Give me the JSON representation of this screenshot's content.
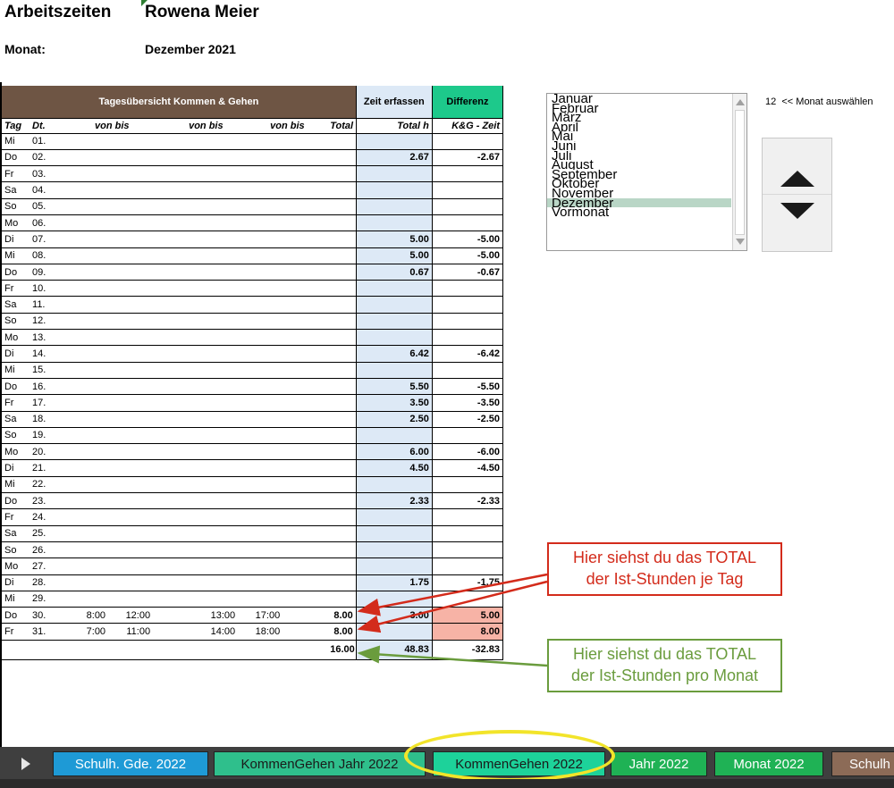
{
  "header": {
    "title": "Arbeitszeiten",
    "name": "Rowena Meier",
    "month_label": "Monat:",
    "month_value": "Dezember 2021"
  },
  "table": {
    "group_header": "Tagesübersicht Kommen & Gehen",
    "col_zeit": "Zeit erfassen",
    "col_diff": "Differenz",
    "sub": {
      "tag": "Tag",
      "dt": "Dt.",
      "vonbis1": "von  bis",
      "vonbis2": "von  bis",
      "vonbis3": "von  bis",
      "total": "Total h",
      "total2": "Total h",
      "kg": "K&G - Zeit"
    },
    "rows": [
      {
        "tag": "Mi",
        "dt": "01.",
        "v1": "",
        "b1": "",
        "v2": "",
        "b2": "",
        "total": "",
        "ze": "",
        "diff": ""
      },
      {
        "tag": "Do",
        "dt": "02.",
        "v1": "",
        "b1": "",
        "v2": "",
        "b2": "",
        "total": "",
        "ze": "2.67",
        "diff": "-2.67"
      },
      {
        "tag": "Fr",
        "dt": "03.",
        "v1": "",
        "b1": "",
        "v2": "",
        "b2": "",
        "total": "",
        "ze": "",
        "diff": ""
      },
      {
        "tag": "Sa",
        "dt": "04.",
        "v1": "",
        "b1": "",
        "v2": "",
        "b2": "",
        "total": "",
        "ze": "",
        "diff": ""
      },
      {
        "tag": "So",
        "dt": "05.",
        "v1": "",
        "b1": "",
        "v2": "",
        "b2": "",
        "total": "",
        "ze": "",
        "diff": ""
      },
      {
        "tag": "Mo",
        "dt": "06.",
        "v1": "",
        "b1": "",
        "v2": "",
        "b2": "",
        "total": "",
        "ze": "",
        "diff": ""
      },
      {
        "tag": "Di",
        "dt": "07.",
        "v1": "",
        "b1": "",
        "v2": "",
        "b2": "",
        "total": "",
        "ze": "5.00",
        "diff": "-5.00"
      },
      {
        "tag": "Mi",
        "dt": "08.",
        "v1": "",
        "b1": "",
        "v2": "",
        "b2": "",
        "total": "",
        "ze": "5.00",
        "diff": "-5.00"
      },
      {
        "tag": "Do",
        "dt": "09.",
        "v1": "",
        "b1": "",
        "v2": "",
        "b2": "",
        "total": "",
        "ze": "0.67",
        "diff": "-0.67"
      },
      {
        "tag": "Fr",
        "dt": "10.",
        "v1": "",
        "b1": "",
        "v2": "",
        "b2": "",
        "total": "",
        "ze": "",
        "diff": ""
      },
      {
        "tag": "Sa",
        "dt": "11.",
        "v1": "",
        "b1": "",
        "v2": "",
        "b2": "",
        "total": "",
        "ze": "",
        "diff": ""
      },
      {
        "tag": "So",
        "dt": "12.",
        "v1": "",
        "b1": "",
        "v2": "",
        "b2": "",
        "total": "",
        "ze": "",
        "diff": ""
      },
      {
        "tag": "Mo",
        "dt": "13.",
        "v1": "",
        "b1": "",
        "v2": "",
        "b2": "",
        "total": "",
        "ze": "",
        "diff": ""
      },
      {
        "tag": "Di",
        "dt": "14.",
        "v1": "",
        "b1": "",
        "v2": "",
        "b2": "",
        "total": "",
        "ze": "6.42",
        "diff": "-6.42"
      },
      {
        "tag": "Mi",
        "dt": "15.",
        "v1": "",
        "b1": "",
        "v2": "",
        "b2": "",
        "total": "",
        "ze": "",
        "diff": ""
      },
      {
        "tag": "Do",
        "dt": "16.",
        "v1": "",
        "b1": "",
        "v2": "",
        "b2": "",
        "total": "",
        "ze": "5.50",
        "diff": "-5.50"
      },
      {
        "tag": "Fr",
        "dt": "17.",
        "v1": "",
        "b1": "",
        "v2": "",
        "b2": "",
        "total": "",
        "ze": "3.50",
        "diff": "-3.50"
      },
      {
        "tag": "Sa",
        "dt": "18.",
        "v1": "",
        "b1": "",
        "v2": "",
        "b2": "",
        "total": "",
        "ze": "2.50",
        "diff": "-2.50"
      },
      {
        "tag": "So",
        "dt": "19.",
        "v1": "",
        "b1": "",
        "v2": "",
        "b2": "",
        "total": "",
        "ze": "",
        "diff": ""
      },
      {
        "tag": "Mo",
        "dt": "20.",
        "v1": "",
        "b1": "",
        "v2": "",
        "b2": "",
        "total": "",
        "ze": "6.00",
        "diff": "-6.00"
      },
      {
        "tag": "Di",
        "dt": "21.",
        "v1": "",
        "b1": "",
        "v2": "",
        "b2": "",
        "total": "",
        "ze": "4.50",
        "diff": "-4.50"
      },
      {
        "tag": "Mi",
        "dt": "22.",
        "v1": "",
        "b1": "",
        "v2": "",
        "b2": "",
        "total": "",
        "ze": "",
        "diff": ""
      },
      {
        "tag": "Do",
        "dt": "23.",
        "v1": "",
        "b1": "",
        "v2": "",
        "b2": "",
        "total": "",
        "ze": "2.33",
        "diff": "-2.33"
      },
      {
        "tag": "Fr",
        "dt": "24.",
        "v1": "",
        "b1": "",
        "v2": "",
        "b2": "",
        "total": "",
        "ze": "",
        "diff": ""
      },
      {
        "tag": "Sa",
        "dt": "25.",
        "v1": "",
        "b1": "",
        "v2": "",
        "b2": "",
        "total": "",
        "ze": "",
        "diff": ""
      },
      {
        "tag": "So",
        "dt": "26.",
        "v1": "",
        "b1": "",
        "v2": "",
        "b2": "",
        "total": "",
        "ze": "",
        "diff": ""
      },
      {
        "tag": "Mo",
        "dt": "27.",
        "v1": "",
        "b1": "",
        "v2": "",
        "b2": "",
        "total": "",
        "ze": "",
        "diff": ""
      },
      {
        "tag": "Di",
        "dt": "28.",
        "v1": "",
        "b1": "",
        "v2": "",
        "b2": "",
        "total": "",
        "ze": "1.75",
        "diff": "-1.75"
      },
      {
        "tag": "Mi",
        "dt": "29.",
        "v1": "",
        "b1": "",
        "v2": "",
        "b2": "",
        "total": "",
        "ze": "",
        "diff": ""
      },
      {
        "tag": "Do",
        "dt": "30.",
        "v1": "8:00",
        "b1": "12:00",
        "v2": "13:00",
        "b2": "17:00",
        "total": "8.00",
        "ze": "3.00",
        "diff": "5.00"
      },
      {
        "tag": "Fr",
        "dt": "31.",
        "v1": "7:00",
        "b1": "11:00",
        "v2": "14:00",
        "b2": "18:00",
        "total": "8.00",
        "ze": "",
        "diff": "8.00"
      }
    ],
    "sum": {
      "total": "16.00",
      "ze": "48.83",
      "diff": "-32.83"
    }
  },
  "monthlist": {
    "items": [
      "Januar",
      "Februar",
      "März",
      "April",
      "Mai",
      "Juni",
      "Juli",
      "August",
      "September",
      "Oktober",
      "November",
      "Dezember",
      "Vormonat"
    ],
    "selected_index": 11
  },
  "month_select": {
    "value": "12",
    "label": "<< Monat auswählen"
  },
  "callouts": {
    "red_line1": "Hier siehst du das TOTAL",
    "red_line2": "der Ist-Stunden je Tag",
    "green_line1": "Hier siehst du das TOTAL",
    "green_line2": "der Ist-Stunden pro Monat"
  },
  "colors": {
    "header_brown": "#6e5544",
    "entry_blue": "#dde9f6",
    "diff_green": "#1dc98b",
    "positive_diff": "#f7b3a6",
    "callout_red": "#d32b1b",
    "callout_green": "#6a9c3d",
    "tab_highlight": "#f2e42a"
  },
  "tabs": [
    {
      "label": "Schulh. Gde. 2022"
    },
    {
      "label": "KommenGehen Jahr 2022"
    },
    {
      "label": "KommenGehen 2022"
    },
    {
      "label": "Jahr 2022"
    },
    {
      "label": "Monat 2022"
    },
    {
      "label": "Schulh"
    }
  ]
}
